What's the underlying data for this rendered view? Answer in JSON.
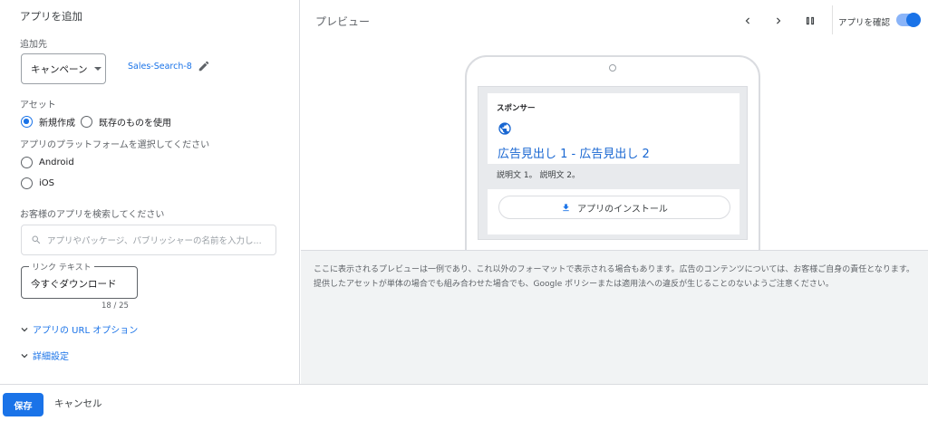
{
  "left": {
    "title": "アプリを追加",
    "destination_label": "追加先",
    "campaign_dropdown": "キャンペーン",
    "campaign_name": "Sales-Search-8",
    "asset_label": "アセット",
    "asset_options": [
      "新規作成",
      "既存のものを使用"
    ],
    "platform_label": "アプリのプラットフォームを選択してください",
    "platforms": [
      "Android",
      "iOS"
    ],
    "search_label": "お客様のアプリを検索してください",
    "search_placeholder": "アプリやパッケージ、パブリッシャーの名前を入力し...",
    "link_text_legend": "リンク テキスト",
    "link_text_value": "今すぐダウンロード",
    "char_counter": "18 / 25",
    "url_options": "アプリの URL オプション",
    "advanced": "詳細設定"
  },
  "preview": {
    "title": "プレビュー",
    "confirm_label": "アプリを確認",
    "sponsor": "スポンサー",
    "headline": "広告見出し 1 - 広告見出し 2",
    "description": "説明文 1。 説明文 2。",
    "install": "アプリのインストール",
    "notice": "ここに表示されるプレビューは一例であり、これ以外のフォーマットで表示される場合もあります。広告のコンテンツについては、お客様ご自身の責任となります。提供したアセットが単体の場合でも組み合わせた場合でも、Google ポリシーまたは適用法への違反が生じることのないようご注意ください。"
  },
  "footer": {
    "save": "保存",
    "cancel": "キャンセル"
  },
  "colors": {
    "accent": "#1a73e8",
    "border": "#dadce0",
    "panel_bg": "#f1f3f4"
  }
}
